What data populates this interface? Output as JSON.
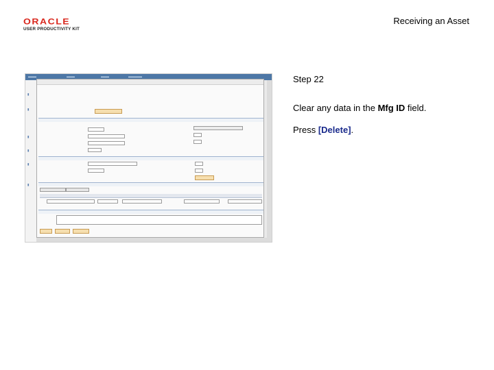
{
  "header": {
    "logo_oracle": "ORACLE",
    "logo_subtitle": "USER PRODUCTIVITY KIT",
    "title": "Receiving an Asset"
  },
  "instructions": {
    "step": "Step 22",
    "line1_prefix": "Clear any data in the ",
    "line1_field": "Mfg ID",
    "line1_suffix": " field.",
    "press_prefix": "Press ",
    "press_key": "[Delete]",
    "press_suffix": "."
  },
  "colors": {
    "brand_red": "#d9261c",
    "key_blue": "#1a2b8c",
    "topbar_blue": "#4d77a6"
  }
}
